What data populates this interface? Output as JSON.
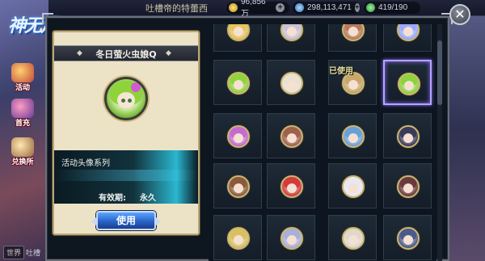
{
  "topbar": {
    "marquee": "吐槽帝的特蕾西",
    "gold": "96,856万",
    "gems": "298,113,471",
    "stamina": "419/190",
    "plus": "+"
  },
  "logo": {
    "text": "神无月"
  },
  "side_menu": [
    {
      "label": "活动",
      "icon": "activity-icon"
    },
    {
      "label": "首充",
      "icon": "recharge-icon"
    },
    {
      "label": "兑换所",
      "icon": "exchange-icon"
    }
  ],
  "chat": {
    "channel": "世界",
    "name": "吐槽"
  },
  "detail": {
    "title": "冬日萤火虫娘Q",
    "series": "活动头像系列",
    "validity_label": "有效期:",
    "validity_value": "永久",
    "use_label": "使用"
  },
  "grid": {
    "used_tag": "已使用",
    "rows": [
      [
        "avatar",
        "avatar",
        "avatar",
        "avatar"
      ],
      [
        "avatar",
        "avatar",
        "avatar-used",
        "avatar-selected"
      ],
      [
        "avatar",
        "avatar",
        "avatar",
        "avatar"
      ],
      [
        "avatar",
        "avatar",
        "avatar",
        "avatar"
      ],
      [
        "avatar",
        "avatar",
        "avatar",
        "avatar"
      ]
    ],
    "palette": [
      [
        "#e6c35a",
        "#c8c2d6",
        "#b87a5a",
        "#9aa8ff"
      ],
      [
        "#8ed33a",
        "#e9e0d0",
        "#c7a86a",
        "#8ed33a"
      ],
      [
        "#c76ad0",
        "#a0604a",
        "#6aa0d8",
        "#3a3a5a"
      ],
      [
        "#8a5a3a",
        "#d43a3a",
        "#e8e8f0",
        "#6a3a3a"
      ],
      [
        "#d8c060",
        "#a8b0d8",
        "#e0d8c8",
        "#4a5a8a"
      ]
    ]
  },
  "colors": {
    "accent": "#2a62c8",
    "selected_border": "#b9a2ff",
    "slot_ring": "#c9b77a"
  }
}
